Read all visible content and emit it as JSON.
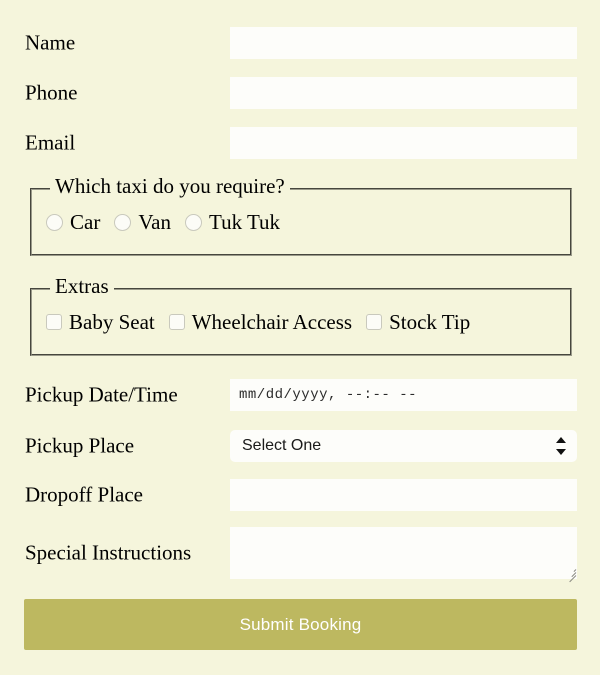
{
  "theme": {
    "page_background": "#f5f5dc",
    "input_background": "#fdfdfa",
    "submit_background": "#bdb860",
    "submit_text_color": "#ffffff",
    "fieldset_border": "#9a9a8a",
    "label_color": "#000000"
  },
  "fields": {
    "name": {
      "label": "Name",
      "value": "",
      "placeholder": ""
    },
    "phone": {
      "label": "Phone",
      "value": "",
      "placeholder": ""
    },
    "email": {
      "label": "Email",
      "value": "",
      "placeholder": ""
    },
    "pickup_datetime": {
      "label": "Pickup Date/Time",
      "value": "",
      "placeholder": "mm/dd/yyyy, --:-- --"
    },
    "pickup_place": {
      "label": "Pickup Place",
      "selected": "Select One"
    },
    "dropoff_place": {
      "label": "Dropoff Place",
      "value": "",
      "placeholder": ""
    },
    "special_instructions": {
      "label": "Special Instructions",
      "value": "",
      "placeholder": ""
    }
  },
  "taxi_group": {
    "legend": "Which taxi do you require?",
    "options": [
      {
        "label": "Car",
        "checked": false
      },
      {
        "label": "Van",
        "checked": false
      },
      {
        "label": "Tuk Tuk",
        "checked": false
      }
    ]
  },
  "extras_group": {
    "legend": "Extras",
    "options": [
      {
        "label": "Baby Seat",
        "checked": false
      },
      {
        "label": "Wheelchair Access",
        "checked": false
      },
      {
        "label": "Stock Tip",
        "checked": false
      }
    ]
  },
  "submit": {
    "label": "Submit Booking"
  }
}
